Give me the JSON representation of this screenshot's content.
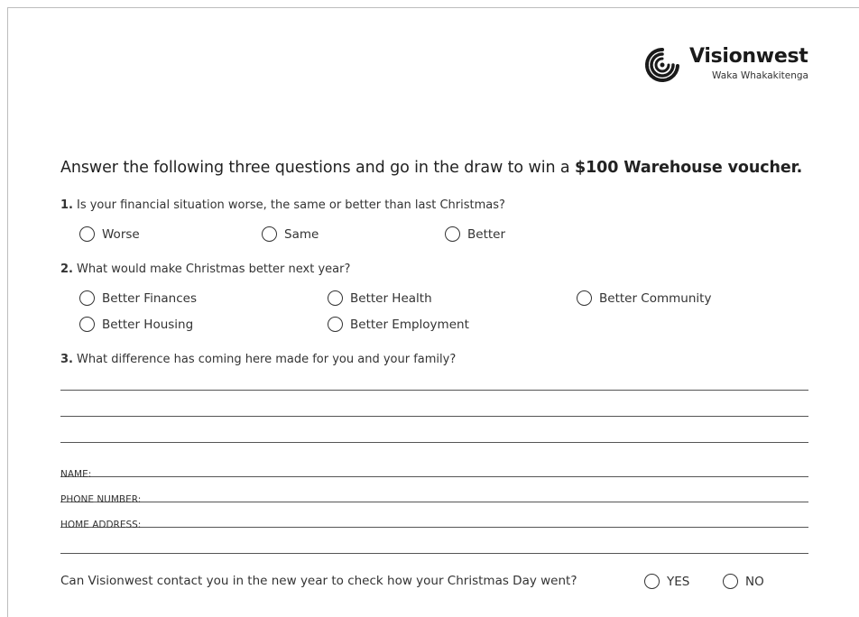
{
  "logo": {
    "name": "Visionwest",
    "tagline": "Waka Whakakitenga"
  },
  "headline": {
    "text": "Answer the following three questions and go in the draw to win a ",
    "bold": "$100 Warehouse voucher."
  },
  "question1": {
    "number": "1.",
    "text": "Is your financial situation worse, the same or better than last Christmas?",
    "options": [
      "Worse",
      "Same",
      "Better"
    ]
  },
  "question2": {
    "number": "2.",
    "text": "What would make Christmas better next year?",
    "options": [
      "Better Finances",
      "Better Health",
      "Better Community",
      "Better Housing",
      "Better Employment"
    ]
  },
  "question3": {
    "number": "3.",
    "text": "What difference has coming here made for you and your family?"
  },
  "fields": {
    "name": "NAME:",
    "phone": "PHONE NUMBER:",
    "address": "HOME ADDRESS:"
  },
  "contact": {
    "text": "Can Visionwest contact you in the new year to check how your Christmas Day went?",
    "yes": "YES",
    "no": "NO"
  }
}
